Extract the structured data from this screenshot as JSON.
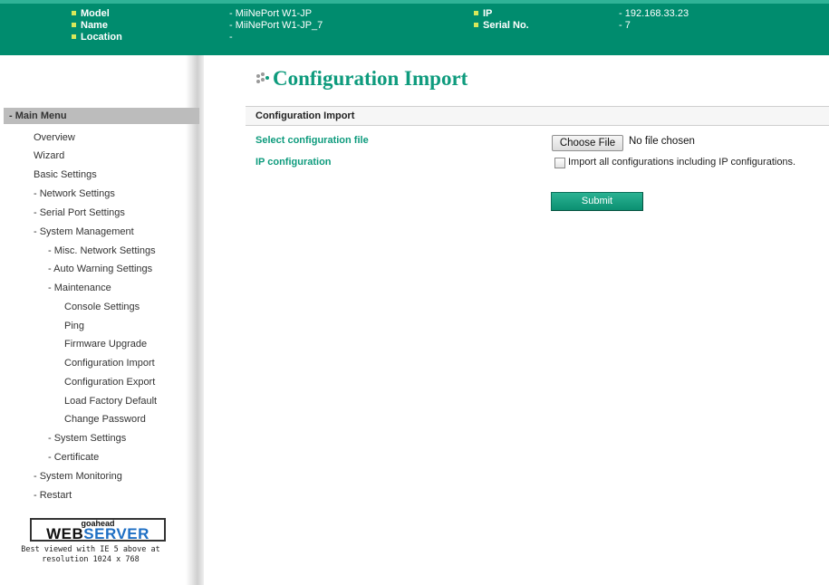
{
  "header": {
    "model_label": "Model",
    "model_value": "- MiiNePort W1-JP",
    "name_label": "Name",
    "name_value": "- MiiNePort W1-JP_7",
    "location_label": "Location",
    "location_value": "-",
    "ip_label": "IP",
    "ip_value": "- 192.168.33.23",
    "serial_label": "Serial No.",
    "serial_value": "- 7"
  },
  "sidebar": {
    "menu_title": "- Main Menu",
    "items": [
      "Overview",
      "Wizard",
      "Basic Settings",
      "- Network Settings",
      "- Serial Port Settings",
      "- System Management",
      "- Misc. Network Settings",
      "- Auto Warning Settings",
      "- Maintenance",
      "Console Settings",
      "Ping",
      "Firmware Upgrade",
      "Configuration Import",
      "Configuration Export",
      "Load Factory Default",
      "Change Password",
      "- System Settings",
      "- Certificate",
      "- System Monitoring",
      "- Restart"
    ],
    "logo_small": "goahead",
    "logo_web": "WEB",
    "logo_server": "SERVER",
    "best_line1": "Best viewed with IE 5 above at",
    "best_line2": "resolution 1024 x 768"
  },
  "main": {
    "title": "Configuration Import",
    "section_title": "Configuration Import",
    "select_file_label": "Select configuration file",
    "choose_file_button": "Choose File",
    "no_file_text": "No file chosen",
    "ip_config_label": "IP configuration",
    "ip_config_checkbox_label": "Import all configurations including IP configurations.",
    "ip_config_checked": false,
    "submit_label": "Submit"
  },
  "colors": {
    "header_bg": "#008c6e",
    "accent_green": "#0e9b7d",
    "bullet": "#d7e85a",
    "logo_blue": "#1e6fc4"
  },
  "icons": {
    "header_bullet": "square-bullet-icon",
    "title_dots": "dots-icon"
  }
}
